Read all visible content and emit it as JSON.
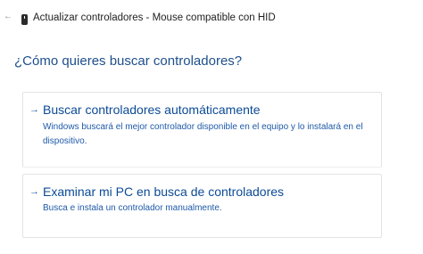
{
  "window": {
    "back_icon": "back-arrow-icon",
    "device_icon": "usb-device-icon",
    "title": "Actualizar controladores - Mouse compatible con HID"
  },
  "main": {
    "question": "¿Cómo quieres buscar controladores?",
    "options": [
      {
        "arrow": "→",
        "title": "Buscar controladores automáticamente",
        "description": "Windows buscará el mejor controlador disponible en el equipo y lo instalará en el dispositivo."
      },
      {
        "arrow": "→",
        "title": "Examinar mi PC en busca de controladores",
        "description": "Busca e instala un controlador manualmente."
      }
    ]
  },
  "colors": {
    "accent": "#0b4a96",
    "link": "#1e5aa8",
    "heading": "#1d4f8c",
    "border": "#e3e3e3"
  }
}
